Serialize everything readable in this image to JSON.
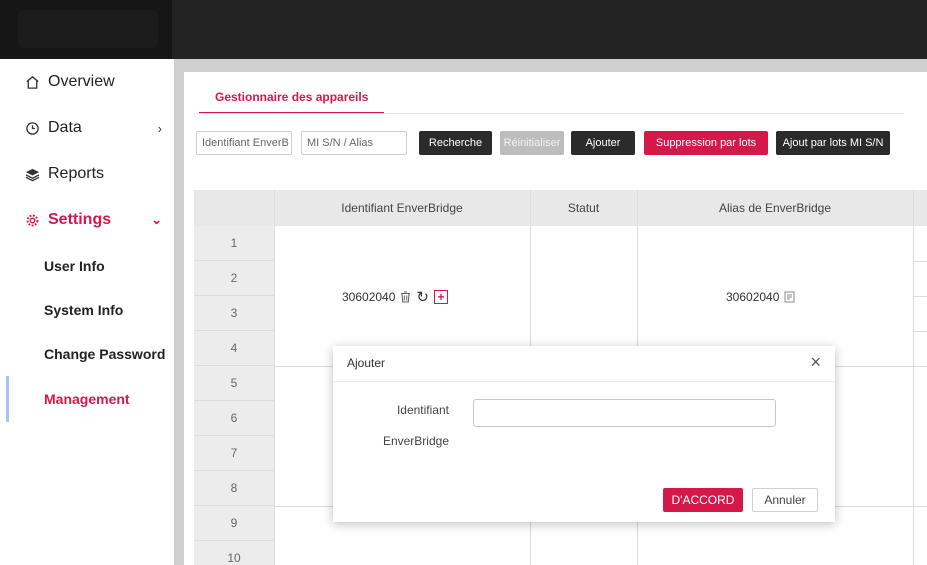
{
  "sidebar": {
    "items": [
      {
        "label": "Overview",
        "icon": "home-icon"
      },
      {
        "label": "Data",
        "icon": "clock-icon"
      },
      {
        "label": "Reports",
        "icon": "layers-icon"
      },
      {
        "label": "Settings",
        "icon": "gear-icon"
      }
    ],
    "submenu": [
      "User Info",
      "System Info",
      "Change Password",
      "Management"
    ]
  },
  "main": {
    "tab": "Gestionnaire des appareils",
    "filters": {
      "enverbridge_id_value": "Identifiant EnverB",
      "mi_placeholder": "MI S/N / Alias"
    },
    "buttons": {
      "search": "Recherche",
      "reset": "Réinitialiser",
      "add": "Ajouter",
      "bulk_delete": "Suppression par lots",
      "bulk_add": "Ajout par lots MI S/N"
    },
    "table": {
      "headers": [
        "Identifiant EnverBridge",
        "Statut",
        "Alias de EnverBridge"
      ],
      "row_numbers": [
        "1",
        "2",
        "3",
        "4",
        "5",
        "6",
        "7",
        "8",
        "9",
        "10"
      ],
      "group": {
        "id": "30602040",
        "alias": "30602040"
      }
    }
  },
  "modal": {
    "title": "Ajouter",
    "label_line1": "Identifiant",
    "label_line2": "EnverBridge",
    "input_value": "",
    "ok": "D'ACCORD",
    "cancel": "Annuler"
  },
  "colors": {
    "accent": "#d4194a",
    "topbar": "#232323",
    "dark_button": "#2b2b2b"
  }
}
